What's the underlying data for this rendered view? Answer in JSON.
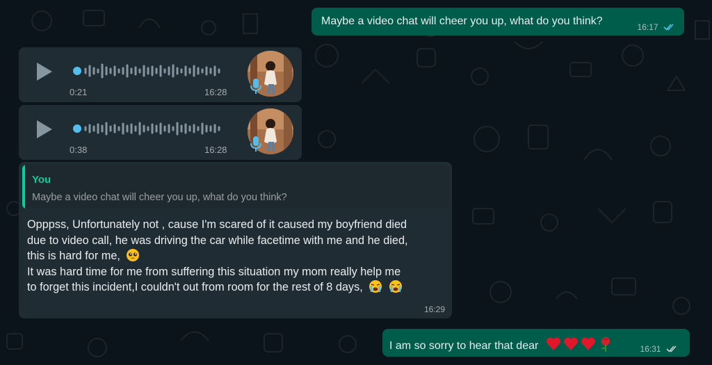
{
  "messages": {
    "outgoing_top": {
      "text": "Maybe a video chat will cheer you up, what do you think?",
      "time": "16:17",
      "status": "read"
    },
    "voice_notes": [
      {
        "duration": "0:21",
        "time": "16:28"
      },
      {
        "duration": "0:38",
        "time": "16:28"
      }
    ],
    "reply": {
      "quoted_author": "You",
      "quoted_text": "Maybe a video chat will cheer you up, what do you think?",
      "lines": [
        "Opppss, Unfortunately not , cause I'm scared of it caused my boyfriend died",
        "due to video call, he was driving the car while facetime with me and he died,",
        "this is hard for me,",
        "It was hard time for me from suffering this situation my mom really help me",
        "to forget this incident,I couldn't out from room for the rest of 8 days,"
      ],
      "time": "16:29"
    },
    "outgoing_bottom": {
      "text": "I am so sorry to hear that dear",
      "time": "16:31",
      "status": "delivered"
    }
  },
  "colors": {
    "background": "#0b141a",
    "outgoing_bubble": "#005c4b",
    "incoming_bubble": "#202c33",
    "accent": "#06cf9c",
    "read_tick": "#53bdeb",
    "voice_dot": "#53bdeb"
  },
  "icons": [
    "play-icon",
    "mic-icon",
    "double-check-icon",
    "pleading-face-emoji",
    "crying-face-emoji",
    "heart-emoji",
    "rose-emoji"
  ]
}
